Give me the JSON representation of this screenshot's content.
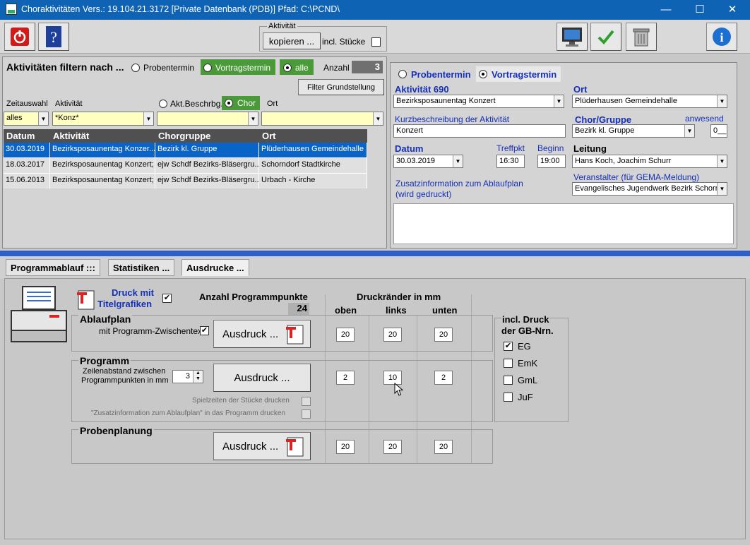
{
  "window": {
    "title": "Choraktivitäten  Vers.: 19.104.21.3172      [Private Datenbank (PDB)]       Pfad: C:\\PCND\\",
    "minimize": "—",
    "maximize": "☐",
    "close": "✕"
  },
  "toolbar": {
    "group_label": "Aktivität",
    "copy_button": "kopieren ...",
    "incl_pieces": "incl. Stücke"
  },
  "filter": {
    "title": "Aktivitäten filtern nach ...",
    "opt_proben": "Probentermin",
    "opt_vortrag": "Vortragstermin",
    "opt_alle": "alle",
    "count_label": "Anzahl",
    "count": "3",
    "reset_button": "Filter Grundstellung",
    "col_zeit": "Zeitauswahl",
    "col_akt": "Aktivität",
    "opt_akt_beschr": "Akt.Beschrbg.",
    "opt_chor": "Chor",
    "col_ort": "Ort",
    "zeit_value": "alles",
    "akt_value": "*Konz*",
    "chor_value": "",
    "ort_value": ""
  },
  "table": {
    "headers": [
      "Datum",
      "Aktivität",
      "Chorgruppe",
      "Ort"
    ],
    "rows": [
      [
        "30.03.2019",
        "Bezirksposaunentag Konzer...",
        "Bezirk kl. Gruppe",
        "Plüderhausen Gemeindehalle"
      ],
      [
        "18.03.2017",
        "Bezirksposaunentag Konzert;",
        "ejw Schdf Bezirks-Bläsergru...",
        "Schorndorf Stadtkirche"
      ],
      [
        "15.06.2013",
        "Bezirksposaunentag Konzert;",
        "ejw Schdf Bezirks-Bläsergru...",
        "Urbach - Kirche"
      ]
    ]
  },
  "detail": {
    "opt_proben": "Probentermin",
    "opt_vortrag": "Vortragstermin",
    "akt_label": "Aktivität  690",
    "akt_value": "Bezirksposaunentag Konzert",
    "ort_label": "Ort",
    "ort_value": "Plüderhausen Gemeindehalle",
    "kurz_label": "Kurzbeschreibung der Aktivität",
    "kurz_value": "Konzert",
    "chor_label": "Chor/Gruppe",
    "chor_value": "Bezirk kl. Gruppe",
    "anw_label": "anwesend",
    "anw_value": "0__",
    "datum_label": "Datum",
    "datum_value": "30.03.2019",
    "treff_label": "Treffpkt",
    "treff_value": "16:30",
    "beginn_label": "Beginn",
    "beginn_value": "19:00",
    "leitung_label": "Leitung",
    "leitung_value": "Hans Koch, Joachim Schurr",
    "zusatz_label1": "Zusatzinformation zum Ablaufplan",
    "zusatz_label2": "(wird gedruckt)",
    "veranst_label": "Veranstalter (für GEMA-Meldung)",
    "veranst_value": "Evangelisches Jugendwerk Bezirk Schorn"
  },
  "tabs": [
    "Programmablauf :::",
    "Statistiken ...",
    "Ausdrucke ..."
  ],
  "print": {
    "druck_mit1": "Druck mit",
    "druck_mit2": "Titelgrafiken",
    "anzahl_label": "Anzahl Programmpunkte",
    "anzahl": "24",
    "raender_label": "Druckränder in mm",
    "oben": "oben",
    "links": "links",
    "unten": "unten",
    "ablauf_title": "Ablaufplan",
    "ablauf_sub": "mit Programm-Zwischentext",
    "ausdruck": "Ausdruck ...",
    "ablauf_vals": [
      "20",
      "20",
      "20"
    ],
    "prog_title": "Programm",
    "prog_sub1": "Zeilenabstand zwischen",
    "prog_sub2": "Programmpunkten in mm",
    "prog_spacing": "3",
    "prog_vals": [
      "2",
      "10",
      "2"
    ],
    "spiel": "Spielzeiten der Stücke drucken",
    "zusatz": "\"Zusatzinformation zum Ablaufplan\" in das Programm drucken",
    "proben_title": "Probenplanung",
    "proben_vals": [
      "20",
      "20",
      "20"
    ],
    "gb_title1": "incl.  Druck",
    "gb_title2": "der GB-Nrn.",
    "gb": [
      "EG",
      "EmK",
      "GmL",
      "JuF"
    ]
  },
  "colors": {
    "title": "#0f63b4",
    "selected": "#0a64c8",
    "blue_label": "#1530b8",
    "green_opt": "#4a9a3a"
  }
}
